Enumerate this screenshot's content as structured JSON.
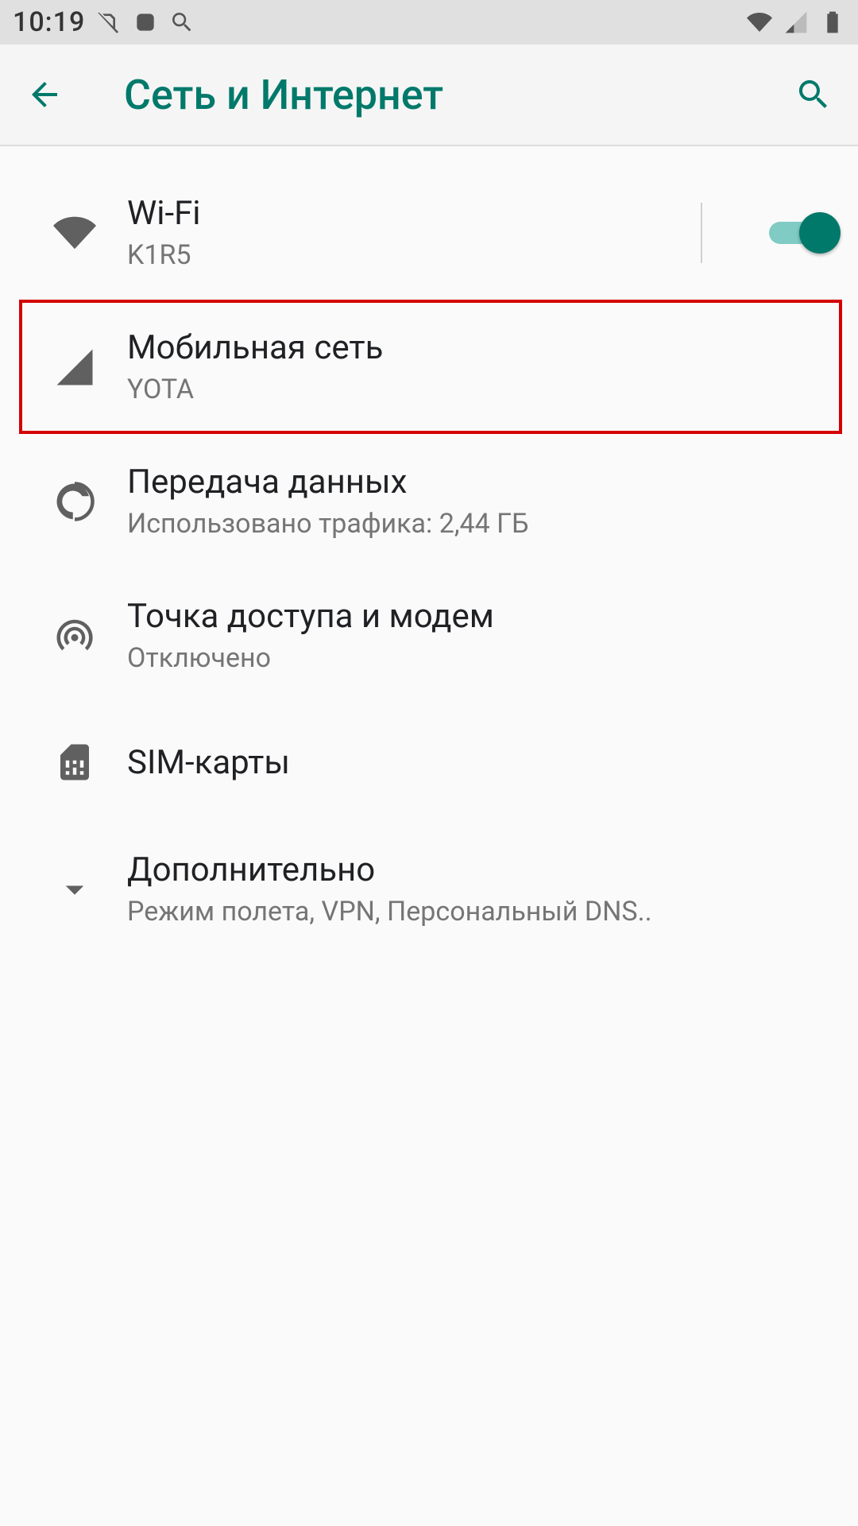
{
  "statusbar": {
    "time": "10:19"
  },
  "appbar": {
    "title": "Сеть и Интернет"
  },
  "items": [
    {
      "title": "Wi-Fi",
      "subtitle": "K1R5",
      "toggle": true,
      "highlighted": false
    },
    {
      "title": "Мобильная сеть",
      "subtitle": "YOTA",
      "highlighted": true
    },
    {
      "title": "Передача данных",
      "subtitle": "Использовано трафика: 2,44 ГБ"
    },
    {
      "title": "Точка доступа и модем",
      "subtitle": "Отключено"
    },
    {
      "title": "SIM-карты",
      "subtitle": ""
    },
    {
      "title": "Дополнительно",
      "subtitle": "Режим полета, VPN, Персональный DNS.."
    }
  ],
  "colors": {
    "accent": "#00796b"
  }
}
